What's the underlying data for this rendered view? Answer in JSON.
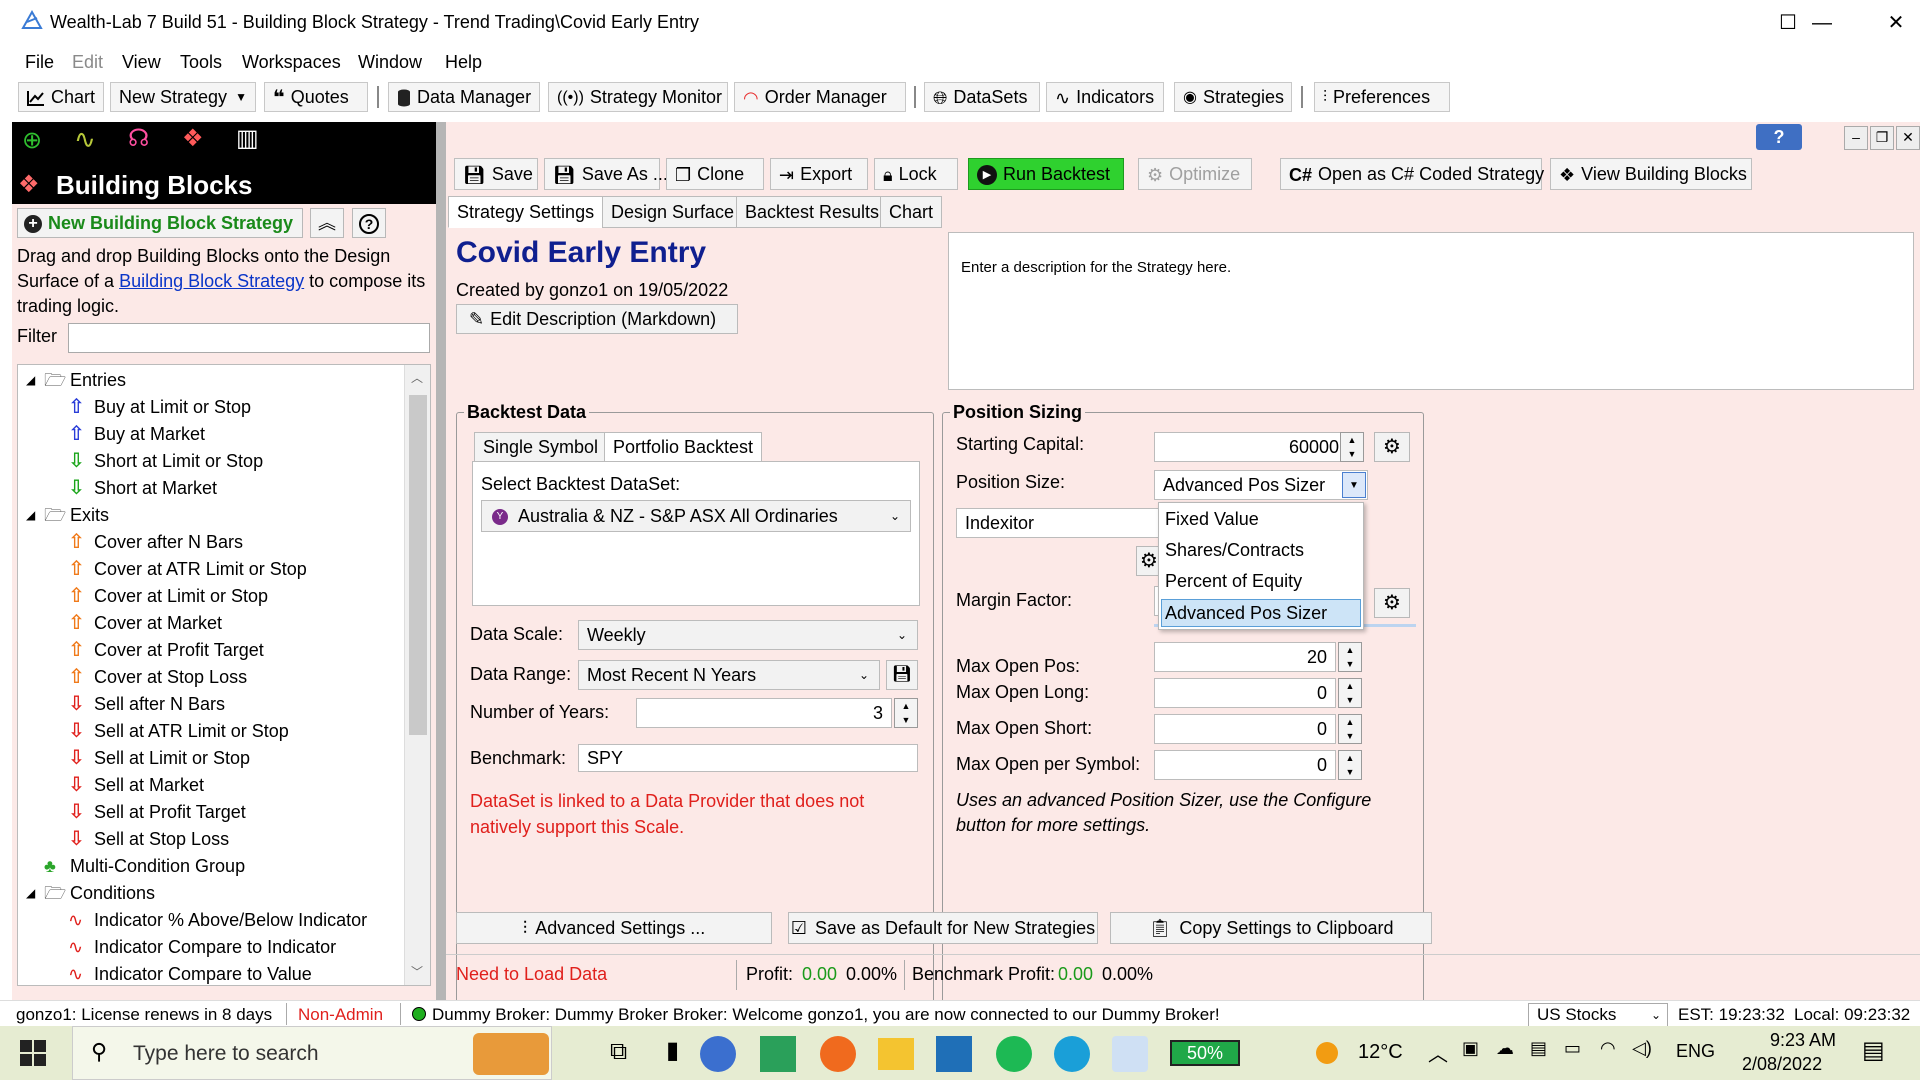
{
  "window": {
    "title": "Wealth-Lab 7 Build 51 - Building Block Strategy - Trend Trading\\Covid Early Entry",
    "min": "—",
    "max": "☐",
    "close": "✕"
  },
  "menu": [
    "File",
    "Edit",
    "View",
    "Tools",
    "Workspaces",
    "Window",
    "Help"
  ],
  "toolbar": {
    "chart": "Chart",
    "new_strategy": "New Strategy",
    "quotes": "Quotes",
    "data_manager": "Data Manager",
    "strategy_monitor": "Strategy Monitor",
    "order_manager": "Order Manager",
    "datasets": "DataSets",
    "indicators": "Indicators",
    "strategies": "Strategies",
    "preferences": "Preferences"
  },
  "left": {
    "title": "Building Blocks",
    "new_bb": "New Building Block Strategy",
    "help_text_a": "Drag and drop Building Blocks onto the Design",
    "help_text_b": "Surface of a ",
    "help_link": "Building Block Strategy",
    "help_text_c": " to compose its",
    "help_text_d": "trading logic.",
    "filter_label": "Filter",
    "filter_value": "",
    "tree": [
      {
        "label": "Entries",
        "type": "folder",
        "level": 0
      },
      {
        "label": "Buy at Limit or Stop",
        "type": "buy",
        "level": 1
      },
      {
        "label": "Buy at Market",
        "type": "buy",
        "level": 1
      },
      {
        "label": "Short at Limit or Stop",
        "type": "short",
        "level": 1
      },
      {
        "label": "Short at Market",
        "type": "short",
        "level": 1
      },
      {
        "label": "Exits",
        "type": "folder",
        "level": 0
      },
      {
        "label": "Cover after N Bars",
        "type": "cover",
        "level": 1
      },
      {
        "label": "Cover at ATR Limit or Stop",
        "type": "cover",
        "level": 1
      },
      {
        "label": "Cover at Limit or Stop",
        "type": "cover",
        "level": 1
      },
      {
        "label": "Cover at Market",
        "type": "cover",
        "level": 1
      },
      {
        "label": "Cover at Profit Target",
        "type": "cover",
        "level": 1
      },
      {
        "label": "Cover at Stop Loss",
        "type": "cover",
        "level": 1
      },
      {
        "label": "Sell after N Bars",
        "type": "sell",
        "level": 1
      },
      {
        "label": "Sell at ATR Limit or Stop",
        "type": "sell",
        "level": 1
      },
      {
        "label": "Sell at Limit or Stop",
        "type": "sell",
        "level": 1
      },
      {
        "label": "Sell at Market",
        "type": "sell",
        "level": 1
      },
      {
        "label": "Sell at Profit Target",
        "type": "sell",
        "level": 1
      },
      {
        "label": "Sell at Stop Loss",
        "type": "sell",
        "level": 1
      },
      {
        "label": "Multi-Condition Group",
        "type": "group",
        "level": 0
      },
      {
        "label": "Conditions",
        "type": "folder",
        "level": 0
      },
      {
        "label": "Indicator % Above/Below Indicator",
        "type": "ind",
        "level": 1
      },
      {
        "label": "Indicator Compare to Indicator",
        "type": "ind",
        "level": 1
      },
      {
        "label": "Indicator Compare to Value",
        "type": "ind",
        "level": 1
      }
    ]
  },
  "main": {
    "help_btn": "?",
    "actions": {
      "save": "Save",
      "save_as": "Save As ...",
      "clone": "Clone",
      "export": "Export",
      "lock": "Lock",
      "run": "Run Backtest",
      "optimize": "Optimize",
      "open_cs": "Open as C# Coded Strategy",
      "view_bb": "View Building Blocks"
    },
    "tabs": [
      "Strategy Settings",
      "Design Surface",
      "Backtest Results",
      "Chart"
    ],
    "strategy_name": "Covid Early Entry",
    "created_by": "Created by gonzo1 on 19/05/2022",
    "edit_desc": "Edit Description (Markdown)",
    "description": "Enter a description for the Strategy here.",
    "backtest": {
      "title": "Backtest Data",
      "tabs": [
        "Single Symbol",
        "Portfolio Backtest"
      ],
      "select_label": "Select Backtest DataSet:",
      "dataset": "Australia & NZ - S&P ASX All Ordinaries",
      "scale_label": "Data Scale:",
      "scale": "Weekly",
      "range_label": "Data Range:",
      "range": "Most Recent N Years",
      "years_label": "Number of Years:",
      "years": "3",
      "bench_label": "Benchmark:",
      "bench": "SPY",
      "warning": "DataSet is linked to a Data Provider that does not natively support this Scale."
    },
    "position": {
      "title": "Position Sizing",
      "capital_label": "Starting Capital:",
      "capital": "60000",
      "size_label": "Position Size:",
      "size": "Advanced Pos Sizer",
      "sizer": "Indexitor",
      "margin_label": "Margin Factor:",
      "options": [
        "Fixed Value",
        "Shares/Contracts",
        "Percent of Equity",
        "Advanced Pos Sizer"
      ],
      "max_open_label": "Max Open Pos:",
      "max_open": "20",
      "max_long_label": "Max Open Long:",
      "max_long": "0",
      "max_short_label": "Max Open Short:",
      "max_short": "0",
      "max_sym_label": "Max Open per Symbol:",
      "max_sym": "0",
      "note": "Uses an advanced Position Sizer, use the Configure button for more settings."
    },
    "bottom": {
      "advanced": "Advanced Settings ...",
      "save_default": "Save as Default for New Strategies",
      "copy": "Copy Settings to Clipboard"
    },
    "status": {
      "need": "Need to Load Data",
      "profit_label": "Profit:",
      "profit": "0.00",
      "profit_pct": "0.00%",
      "bench_label": "Benchmark Profit:",
      "bench": "0.00",
      "bench_pct": "0.00%"
    }
  },
  "statusbar": {
    "license": "gonzo1: License renews in 8 days",
    "admin": "Non-Admin",
    "broker": "Dummy Broker: Dummy Broker Broker: Welcome gonzo1, you are now connected to our Dummy Broker!",
    "market": "US Stocks",
    "est": "EST: 19:23:32",
    "local": "Local: 09:23:32"
  },
  "taskbar": {
    "search": "Type here to search",
    "battery": "50%",
    "temp": "12°C",
    "lang": "ENG",
    "time": "9:23 AM",
    "date": "2/08/2022"
  },
  "colors": {
    "accent_green": "#2fbf2f",
    "left_bg": "#fce9e7",
    "link": "#0a35c8",
    "warning": "#e0201c",
    "title_blue": "#0f1f8f"
  }
}
